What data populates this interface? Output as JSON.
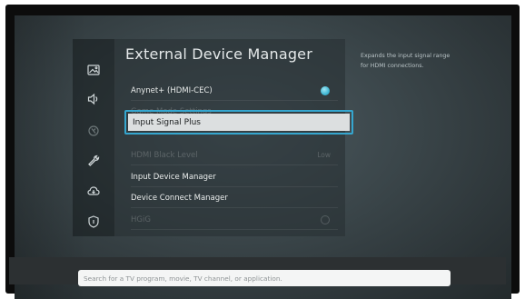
{
  "panel": {
    "title": "External Device Manager",
    "items": [
      {
        "label": "Anynet+ (HDMI-CEC)",
        "state": "on"
      },
      {
        "label": "Game Mode Settings",
        "state": "disabled"
      },
      {
        "label": "Input Signal Plus",
        "state": "selected"
      },
      {
        "label": "HDMI Black Level",
        "value": "Low",
        "state": "disabled"
      },
      {
        "label": "Input Device Manager",
        "state": "enabled"
      },
      {
        "label": "Device Connect Manager",
        "state": "enabled"
      },
      {
        "label": "HGiG",
        "state": "disabled-off"
      }
    ]
  },
  "help": {
    "text": "Expands the input signal range for HDMI connections."
  },
  "search": {
    "placeholder": "Search for a TV program, movie, TV channel, or application."
  },
  "rail_icons": [
    "picture-icon",
    "sound-icon",
    "broadcasting-icon",
    "general-icon",
    "support-icon",
    "privacy-icon"
  ],
  "colors": {
    "accent": "#35a6cf",
    "toggle_on": "#3fb7d4"
  }
}
